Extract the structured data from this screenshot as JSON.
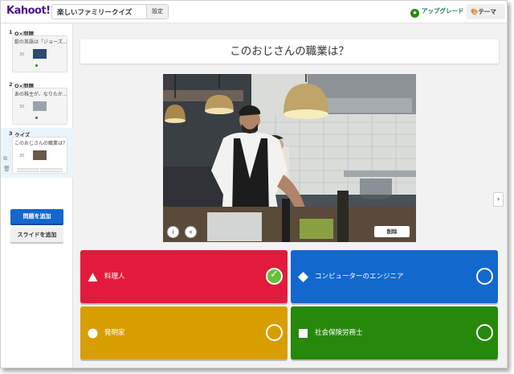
{
  "app": {
    "logo": "Kahoot!",
    "quiz_title": "楽しいファミリークイズ",
    "settings_label": "設定"
  },
  "header": {
    "upgrade_label": "アップグレード",
    "theme_label": "テーマ",
    "upgrade_icon": "star-icon",
    "theme_icon": "palette-icon"
  },
  "sidebar": {
    "slides": [
      {
        "number": "1",
        "type": "O×問題",
        "text": "飲の英語は「ジョーズ...",
        "time": "30"
      },
      {
        "number": "2",
        "type": "O×問題",
        "text": "あの株主が、なりたか...",
        "time": "30"
      },
      {
        "number": "3",
        "type": "クイズ",
        "text": "このおじさんの職業は？",
        "time": "30"
      }
    ],
    "add_question_label": "問題を追加",
    "add_slide_label": "スライドを追加"
  },
  "question": {
    "text": "このおじさんの職業は？"
  },
  "media": {
    "delete_label": "削除",
    "info_icon": "info-icon",
    "crop_icon": "crop-icon"
  },
  "answers": [
    {
      "label": "料理人",
      "color": "#e21b3c",
      "shape": "triangle",
      "correct": true
    },
    {
      "label": "コンピューターのエンジニア",
      "color": "#1368ce",
      "shape": "diamond",
      "correct": false
    },
    {
      "label": "発明家",
      "color": "#d89e00",
      "shape": "circle",
      "correct": false
    },
    {
      "label": "社会保険労務士",
      "color": "#26890c",
      "shape": "square",
      "correct": false
    }
  ],
  "next_arrow": "›"
}
